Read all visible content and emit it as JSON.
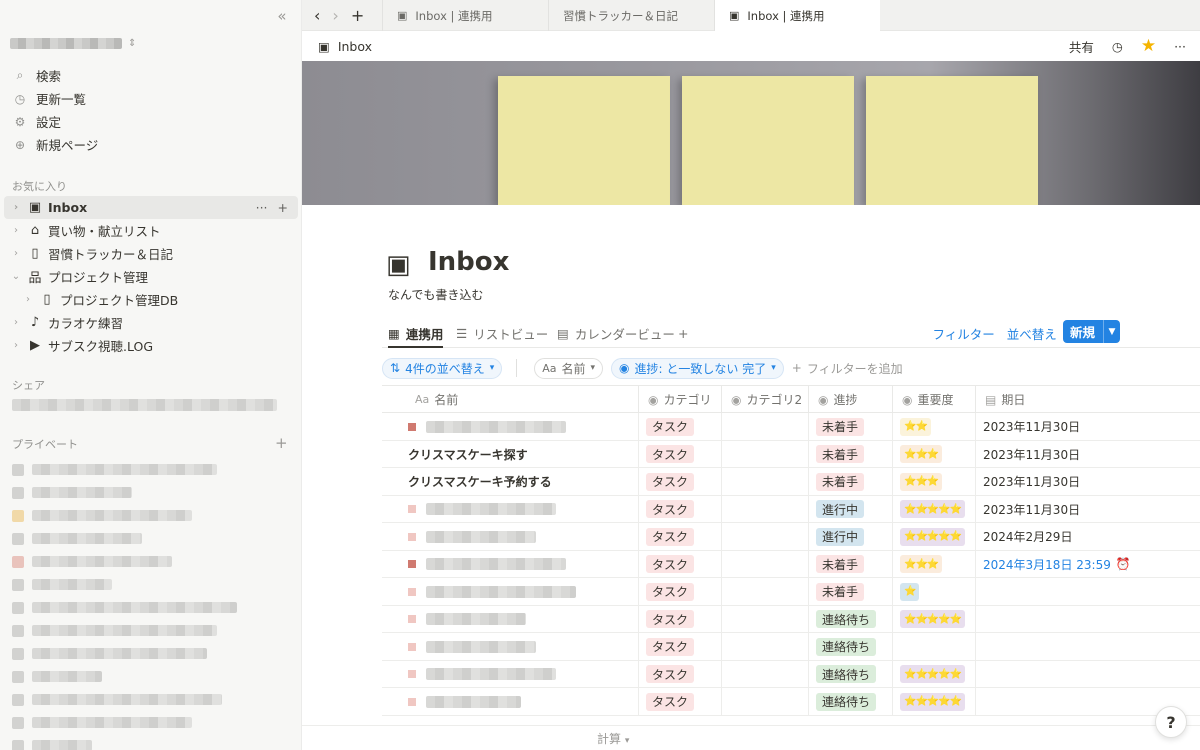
{
  "sidebar": {
    "collapse_icon": "double-chevron-left-icon",
    "menu": [
      {
        "icon": "search-icon",
        "glyph": "⌕",
        "label": "検索"
      },
      {
        "icon": "clock-icon",
        "glyph": "◷",
        "label": "更新一覧"
      },
      {
        "icon": "gear-icon",
        "glyph": "⚙",
        "label": "設定"
      },
      {
        "icon": "plus-circle-icon",
        "glyph": "⊕",
        "label": "新規ページ"
      }
    ],
    "favorites_title": "お気に入り",
    "favorites": [
      {
        "label": "Inbox",
        "icon": "archive-box-icon",
        "glyph": "▣",
        "active": true
      },
      {
        "label": "買い物・献立リスト",
        "icon": "house-icon",
        "glyph": "⌂"
      },
      {
        "label": "習慣トラッカー＆日記",
        "icon": "page-icon",
        "glyph": "▯"
      },
      {
        "label": "プロジェクト管理",
        "icon": "hierarchy-icon",
        "glyph": "品",
        "expanded": true
      },
      {
        "label": "プロジェクト管理DB",
        "icon": "page-icon",
        "glyph": "▯",
        "child": true
      },
      {
        "label": "カラオケ練習",
        "icon": "microphone-icon",
        "glyph": "♪"
      },
      {
        "label": "サブスク視聴.LOG",
        "icon": "tv-icon",
        "glyph": "▶"
      }
    ],
    "shared_title": "シェア",
    "private_title": "プライベート"
  },
  "tabs": [
    {
      "label": "Inbox | 連携用",
      "active": false
    },
    {
      "label": "習慣トラッカー＆日記",
      "active": false
    },
    {
      "label": "Inbox | 連携用",
      "active": true
    }
  ],
  "topbar": {
    "breadcrumb": "Inbox",
    "share": "共有"
  },
  "page": {
    "title": "Inbox",
    "description": "なんでも書き込む"
  },
  "views": {
    "tabs": [
      {
        "label": "連携用",
        "icon": "table-icon",
        "glyph": "▦",
        "active": true
      },
      {
        "label": "リストビュー",
        "icon": "list-icon",
        "glyph": "☰"
      },
      {
        "label": "カレンダービュー",
        "icon": "calendar-icon",
        "glyph": "▤"
      }
    ],
    "filter": "フィルター",
    "sort": "並べ替え",
    "new": "新規"
  },
  "filters": {
    "sort_pill": "4件の並べ替え",
    "name_pill": "名前",
    "progress_pill": "進捗: と一致しない 完了",
    "add_filter": "フィルターを追加"
  },
  "table": {
    "columns": [
      "名前",
      "カテゴリ",
      "カテゴリ2",
      "進捗",
      "重要度",
      "期日"
    ],
    "rows": [
      {
        "name": "",
        "category": "タスク",
        "progress": "未着手",
        "p": "red",
        "stars": "⭐⭐",
        "s": "yel",
        "date": "2023年11月30日"
      },
      {
        "name": "クリスマスケーキ探す",
        "category": "タスク",
        "progress": "未着手",
        "p": "red",
        "stars": "⭐⭐⭐",
        "s": "orn",
        "date": "2023年11月30日"
      },
      {
        "name": "クリスマスケーキ予約する",
        "category": "タスク",
        "progress": "未着手",
        "p": "red",
        "stars": "⭐⭐⭐",
        "s": "orn",
        "date": "2023年11月30日"
      },
      {
        "name": "",
        "category": "タスク",
        "progress": "進行中",
        "p": "blue",
        "stars": "⭐⭐⭐⭐⭐",
        "s": "pur",
        "date": "2023年11月30日"
      },
      {
        "name": "",
        "category": "タスク",
        "progress": "進行中",
        "p": "blue",
        "stars": "⭐⭐⭐⭐⭐",
        "s": "pur",
        "date": "2024年2月29日"
      },
      {
        "name": "",
        "category": "タスク",
        "progress": "未着手",
        "p": "red",
        "stars": "⭐⭐⭐",
        "s": "orn",
        "date": "2024年3月18日 23:59",
        "date_blue": true
      },
      {
        "name": "",
        "category": "タスク",
        "progress": "未着手",
        "p": "red",
        "stars": "⭐",
        "s": "blu",
        "date": ""
      },
      {
        "name": "",
        "category": "タスク",
        "progress": "連絡待ち",
        "p": "green",
        "stars": "⭐⭐⭐⭐⭐",
        "s": "pur",
        "date": ""
      },
      {
        "name": "",
        "category": "タスク",
        "progress": "連絡待ち",
        "p": "green",
        "stars": "",
        "s": "",
        "date": ""
      },
      {
        "name": "",
        "category": "タスク",
        "progress": "連絡待ち",
        "p": "green",
        "stars": "⭐⭐⭐⭐⭐",
        "s": "pur",
        "date": ""
      },
      {
        "name": "",
        "category": "タスク",
        "progress": "連絡待ち",
        "p": "green",
        "stars": "⭐⭐⭐⭐⭐",
        "s": "pur",
        "date": ""
      }
    ]
  },
  "footer": {
    "calc": "計算"
  },
  "help": "?",
  "colors": {
    "accent": "#2383e2",
    "sidebar_bg": "#f7f7f5",
    "note": "#ede7a4"
  }
}
